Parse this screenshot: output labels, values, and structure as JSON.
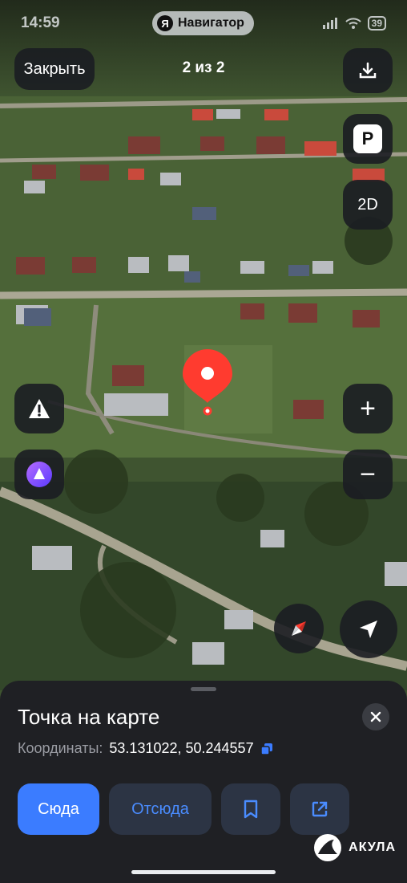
{
  "status_bar": {
    "time": "14:59",
    "app_pill": "Навигатор",
    "app_pill_logo": "Я",
    "battery": "39",
    "icons": [
      "location-arrow-icon",
      "signal-icon",
      "wifi-icon",
      "battery-icon"
    ]
  },
  "header": {
    "close_label": "Закрыть",
    "counter": "2 из 2"
  },
  "map_controls": {
    "download_icon": "download-icon",
    "parking_label": "P",
    "view_mode_label": "2D",
    "zoom_in_label": "+",
    "zoom_out_label": "−",
    "alert_icon": "warning-icon",
    "alice_icon": "alice-assistant-icon",
    "compass_icon": "compass-icon",
    "locate_icon": "locate-me-icon"
  },
  "sheet": {
    "title": "Точка на карте",
    "coords_label": "Координаты:",
    "coords_value": "53.131022, 50.244557",
    "buttons": {
      "here": "Сюда",
      "from_here": "Отсюда"
    }
  },
  "brand": {
    "name": "АКУЛА"
  },
  "colors": {
    "accent": "#3b7cff",
    "pin": "#ff3b2f",
    "sheet_bg": "#1f2024"
  }
}
